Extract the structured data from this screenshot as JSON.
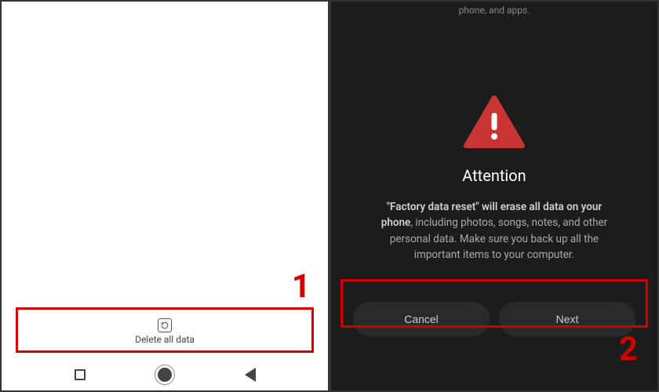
{
  "left": {
    "delete_label": "Delete all data",
    "step_number": "1"
  },
  "right": {
    "partial_top": "phone, and apps.",
    "title": "Attention",
    "body_bold": "\"Factory data reset\" will erase all data on your phone",
    "body_rest": ", including photos, songs, notes, and other personal data. Make sure you back up all the important items to your computer.",
    "cancel": "Cancel",
    "next": "Next",
    "step_number": "2"
  },
  "colors": {
    "red": "#d40000",
    "dark_bg": "#1c1c1c"
  }
}
